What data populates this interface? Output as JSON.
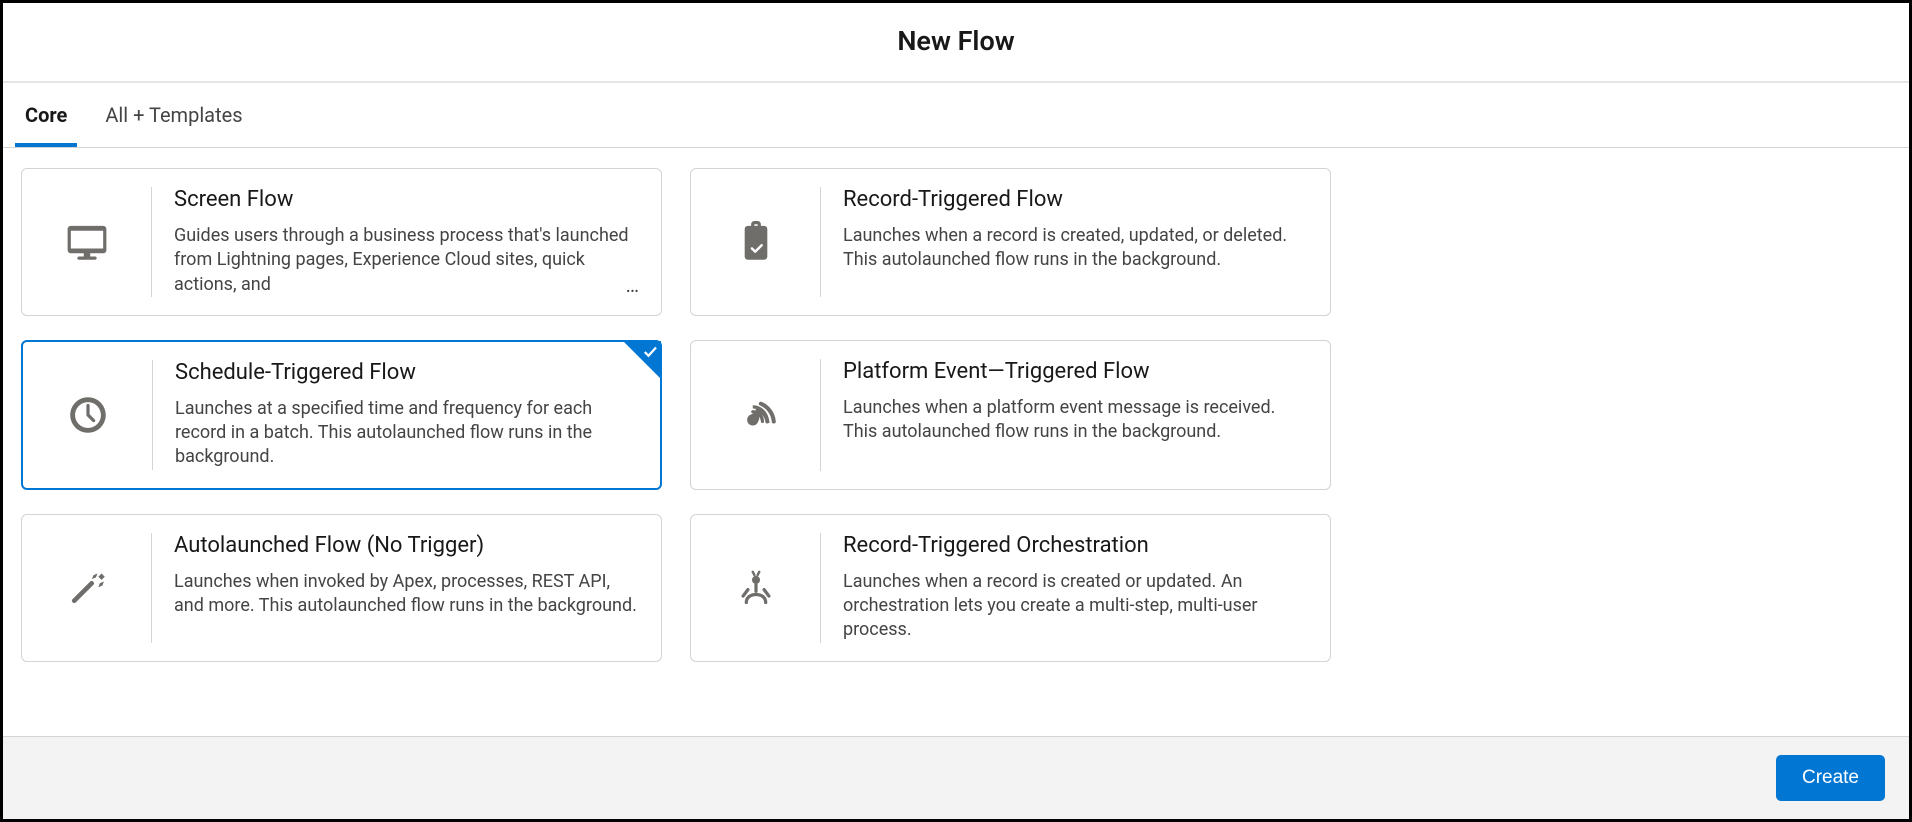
{
  "header": {
    "title": "New Flow"
  },
  "tabs": [
    {
      "label": "Core",
      "active": true
    },
    {
      "label": "All + Templates",
      "active": false
    }
  ],
  "cards": [
    {
      "title": "Screen Flow",
      "desc": "Guides users through a business process that's launched from Lightning pages, Experience Cloud sites, quick actions, and",
      "truncated": true,
      "selected": false,
      "icon": "screen"
    },
    {
      "title": "Record-Triggered Flow",
      "desc": "Launches when a record is created, updated, or deleted. This autolaunched flow runs in the background.",
      "truncated": false,
      "selected": false,
      "icon": "clipboard"
    },
    {
      "title": "Schedule-Triggered Flow",
      "desc": "Launches at a specified time and frequency for each record in a batch. This autolaunched flow runs in the background.",
      "truncated": false,
      "selected": true,
      "icon": "clock"
    },
    {
      "title": "Platform Event—Triggered Flow",
      "desc": "Launches when a platform event message is received. This autolaunched flow runs in the background.",
      "truncated": false,
      "selected": false,
      "icon": "antenna"
    },
    {
      "title": "Autolaunched Flow (No Trigger)",
      "desc": "Launches when invoked by Apex, processes, REST API, and more. This autolaunched flow runs in the background.",
      "truncated": false,
      "selected": false,
      "icon": "wand"
    },
    {
      "title": "Record-Triggered Orchestration",
      "desc": "Launches when a record is created or updated. An orchestration lets you create a multi-step, multi-user process.",
      "truncated": false,
      "selected": false,
      "icon": "orchestration"
    }
  ],
  "footer": {
    "create_label": "Create"
  }
}
